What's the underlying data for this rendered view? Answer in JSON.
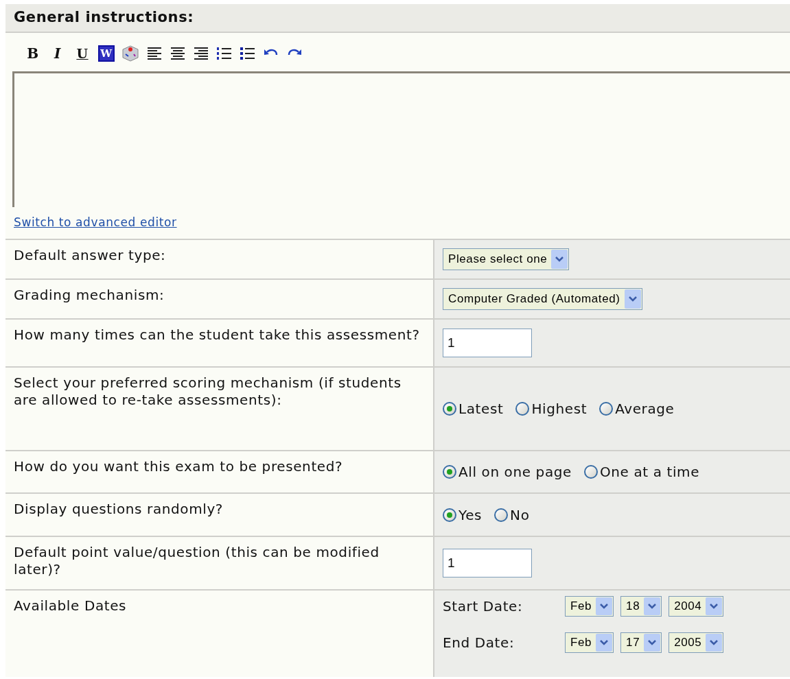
{
  "section_title": "General instructions:",
  "toolbar": [
    {
      "kind": "bold",
      "label": "B"
    },
    {
      "kind": "italic",
      "label": "I"
    },
    {
      "kind": "underline",
      "label": "U"
    },
    {
      "kind": "word",
      "label": "W"
    },
    {
      "kind": "spellcheck"
    },
    {
      "kind": "align-left"
    },
    {
      "kind": "align-center"
    },
    {
      "kind": "align-right"
    },
    {
      "kind": "ordered-list"
    },
    {
      "kind": "bullet-list"
    },
    {
      "kind": "undo"
    },
    {
      "kind": "redo"
    }
  ],
  "editor_link": "Switch to advanced editor",
  "rows": [
    {
      "label": "Default answer type:",
      "kind": "select",
      "value": "Please select one"
    },
    {
      "label": "Grading mechanism:",
      "kind": "select",
      "value": "Computer Graded (Automated)"
    },
    {
      "label": "How many times can the student take this assessment?",
      "kind": "input",
      "value": "1"
    },
    {
      "label": "Select your preferred scoring mechanism (if students are allowed to re-take assessments):",
      "kind": "radio",
      "options": [
        {
          "label": "Latest",
          "selected": true
        },
        {
          "label": "Highest",
          "selected": false
        },
        {
          "label": "Average",
          "selected": false
        }
      ]
    },
    {
      "label": "How do you want this exam to be presented?",
      "kind": "radio",
      "options": [
        {
          "label": "All on one page",
          "selected": true
        },
        {
          "label": "One at a time",
          "selected": false
        }
      ]
    },
    {
      "label": "Display questions randomly?",
      "kind": "radio",
      "options": [
        {
          "label": "Yes",
          "selected": true
        },
        {
          "label": "No",
          "selected": false
        }
      ]
    },
    {
      "label": "Default point value/question (this can be modified later)?",
      "kind": "input",
      "value": "1"
    },
    {
      "label": "Available Dates",
      "kind": "dates",
      "dates": [
        {
          "label": "Start Date:",
          "month": "Feb",
          "day": "18",
          "year": "2004"
        },
        {
          "label": "End Date:",
          "month": "Feb",
          "day": "17",
          "year": "2005"
        }
      ]
    }
  ]
}
